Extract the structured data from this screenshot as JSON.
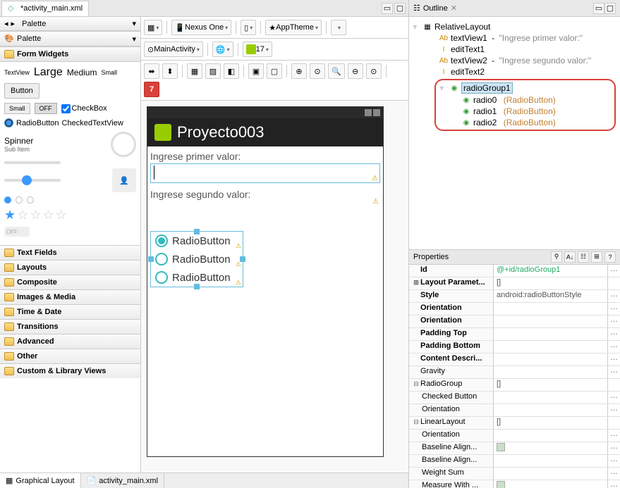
{
  "editor_tab": {
    "filename": "*activity_main.xml"
  },
  "palette": {
    "title": "Palette",
    "subtitle": "Palette",
    "form_widgets": "Form Widgets",
    "textview": "TextView",
    "large": "Large",
    "medium": "Medium",
    "small": "Small",
    "button": "Button",
    "small_btn": "Small",
    "off_btn": "OFF",
    "checkbox": "CheckBox",
    "radiobutton": "RadioButton",
    "checkedtextview": "CheckedTextView",
    "spinner": "Spinner",
    "subitem": "Sub Item",
    "switch_off": "OFF",
    "categories": {
      "text_fields": "Text Fields",
      "layouts": "Layouts",
      "composite": "Composite",
      "images_media": "Images & Media",
      "time_date": "Time & Date",
      "transitions": "Transitions",
      "advanced": "Advanced",
      "other": "Other",
      "custom": "Custom & Library Views"
    }
  },
  "toolbar": {
    "device": "Nexus One",
    "theme": "AppTheme",
    "activity": "MainActivity",
    "api": "17",
    "issues": "7"
  },
  "preview": {
    "app_title": "Proyecto003",
    "label1": "Ingrese primer valor:",
    "label2": "Ingrese segundo valor:",
    "rb_label": "RadioButton"
  },
  "bottom_tabs": {
    "graphical": "Graphical Layout",
    "xml": "activity_main.xml"
  },
  "outline": {
    "title": "Outline",
    "root": "RelativeLayout",
    "textview1": "textView1",
    "textview1_desc": "\"Ingrese primer valor:\"",
    "edittext1": "editText1",
    "textview2": "textView2",
    "textview2_desc": "\"Ingrese segundo valor:\"",
    "edittext2": "editText2",
    "radiogroup1": "radioGroup1",
    "radio0": "radio0",
    "radio1": "radio1",
    "radio2": "radio2",
    "radio_type": "(RadioButton)"
  },
  "properties": {
    "title": "Properties",
    "id_label": "Id",
    "id_value": "@+id/radioGroup1",
    "layout_params": "Layout Paramet...",
    "style": "Style",
    "style_value": "android:radioButtonStyle",
    "orientation": "Orientation",
    "padding_top": "Padding Top",
    "padding_bottom": "Padding Bottom",
    "content_desc": "Content Descri...",
    "gravity": "Gravity",
    "radiogroup": "RadioGroup",
    "checked_button": "Checked Button",
    "linearlayout": "LinearLayout",
    "baseline_align": "Baseline Align...",
    "weight_sum": "Weight Sum",
    "measure_with": "Measure With ...",
    "bracket": "[]"
  }
}
